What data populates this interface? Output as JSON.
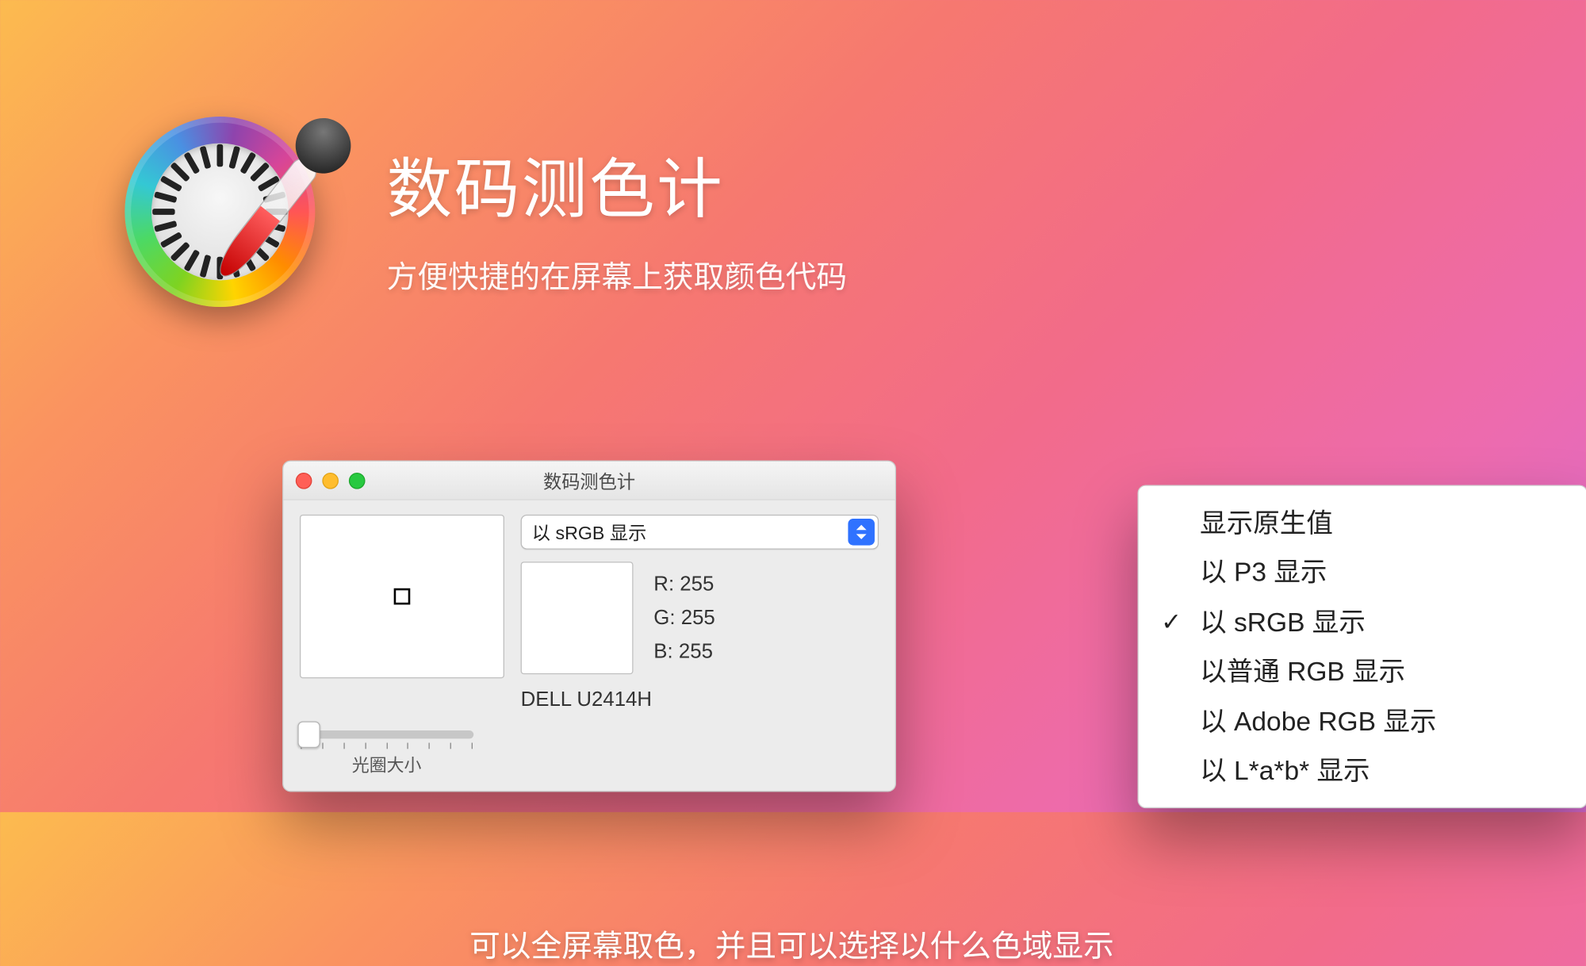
{
  "header": {
    "title": "数码测色计",
    "subtitle": "方便快捷的在屏幕上获取颜色代码"
  },
  "window": {
    "title": "数码测色计",
    "colorspace_selected": "以 sRGB 显示",
    "r_label": "R:",
    "g_label": "G:",
    "b_label": "B:",
    "r_value": "255",
    "g_value": "255",
    "b_value": "255",
    "display_name": "DELL U2414H",
    "aperture_label": "光圈大小"
  },
  "menu": {
    "items": [
      {
        "label": "显示原生值",
        "checked": false
      },
      {
        "label": "以 P3 显示",
        "checked": false
      },
      {
        "label": "以 sRGB 显示",
        "checked": true
      },
      {
        "label": "以普通 RGB 显示",
        "checked": false
      },
      {
        "label": "以 Adobe RGB 显示",
        "checked": false
      },
      {
        "label": "以 L*a*b* 显示",
        "checked": false
      }
    ]
  },
  "caption": "可以全屏幕取色，并且可以选择以什么色域显示"
}
